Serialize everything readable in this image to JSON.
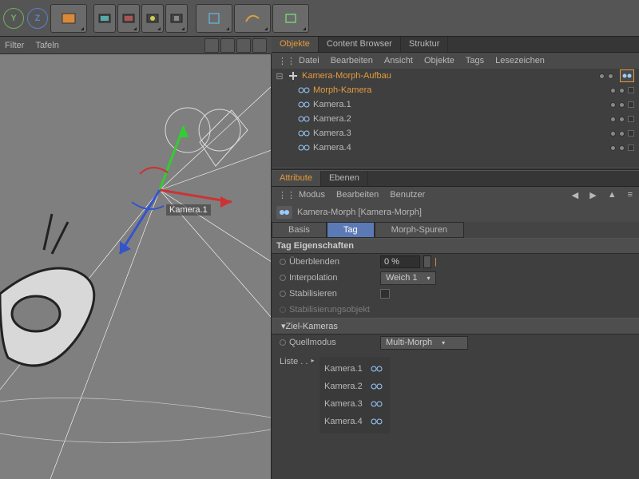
{
  "toolbar": {
    "axes": [
      "Y",
      "Z"
    ],
    "filter": "Filter",
    "panels": "Tafeln"
  },
  "panel_tabs": {
    "objects": "Objekte",
    "content_browser": "Content Browser",
    "structure": "Struktur"
  },
  "obj_menu": {
    "file": "Datei",
    "edit": "Bearbeiten",
    "view": "Ansicht",
    "objects": "Objekte",
    "tags": "Tags",
    "bookmarks": "Lesezeichen"
  },
  "tree": {
    "root": "Kamera-Morph-Aufbau",
    "morph": "Morph-Kamera",
    "cams": [
      "Kamera.1",
      "Kamera.2",
      "Kamera.3",
      "Kamera.4"
    ]
  },
  "viewport": {
    "label": "Kamera.1"
  },
  "attr_tabs": {
    "attributes": "Attribute",
    "layers": "Ebenen"
  },
  "attr_menu": {
    "mode": "Modus",
    "edit": "Bearbeiten",
    "user": "Benutzer"
  },
  "attr_title": "Kamera-Morph [Kamera-Morph]",
  "mode_tabs": {
    "basis": "Basis",
    "tag": "Tag",
    "morph": "Morph-Spuren"
  },
  "section": {
    "tag_props": "Tag Eigenschaften",
    "target": "▾Ziel-Kameras"
  },
  "props": {
    "blend_label": "Überblenden",
    "blend_value": "0 %",
    "interp_label": "Interpolation",
    "interp_value": "Weich 1",
    "stab_label": "Stabilisieren",
    "stab_obj_label": "Stabilisierungsobjekt",
    "source_label": "Quellmodus",
    "source_value": "Multi-Morph",
    "list_label": "Liste . .",
    "list_items": [
      "Kamera.1",
      "Kamera.2",
      "Kamera.3",
      "Kamera.4"
    ]
  }
}
